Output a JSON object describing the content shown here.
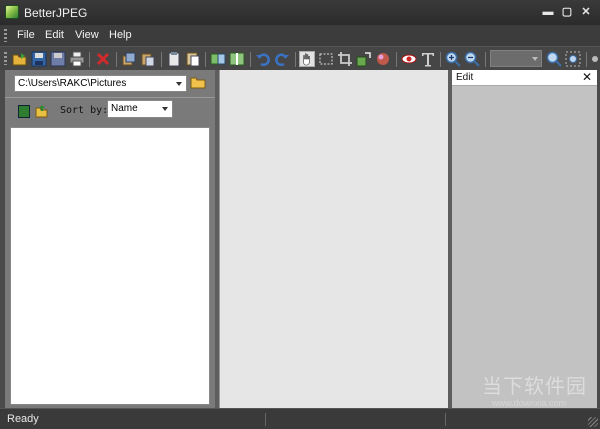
{
  "window": {
    "title": "BetterJPEG",
    "minimize_glyph": "▬",
    "maximize_glyph": "▢",
    "close_glyph": "✕"
  },
  "menu": {
    "items": [
      "File",
      "Edit",
      "View",
      "Help"
    ]
  },
  "toolbar": {
    "zoom_value": "",
    "icons": [
      "open-icon",
      "save-icon",
      "save-as-icon",
      "print-icon",
      "delete-icon",
      "copy-icon",
      "paste-icon",
      "clipboard-icon",
      "compare-icon",
      "split-icon",
      "undo-icon",
      "redo-icon",
      "hand-icon",
      "select-icon",
      "crop-icon",
      "resize-icon",
      "color-icon",
      "red-eye-icon",
      "text-icon",
      "zoom-in-icon",
      "zoom-out-icon",
      "zoom-fit-icon",
      "zoom-actual-icon"
    ]
  },
  "browser": {
    "path": "C:\\Users\\RAKC\\Pictures",
    "sort_label": "Sort by:",
    "sort_value": "Name"
  },
  "edit_panel": {
    "title": "Edit",
    "close_glyph": "✕"
  },
  "watermark": {
    "main": "当下软件园",
    "sub": "www.downxia.com"
  },
  "status": {
    "text": "Ready"
  },
  "colors": {
    "title_bar": "#2f2f2f",
    "toolbar": "#464646",
    "canvas": "#e6e6e6",
    "edit_panel": "#c2c2c2"
  }
}
